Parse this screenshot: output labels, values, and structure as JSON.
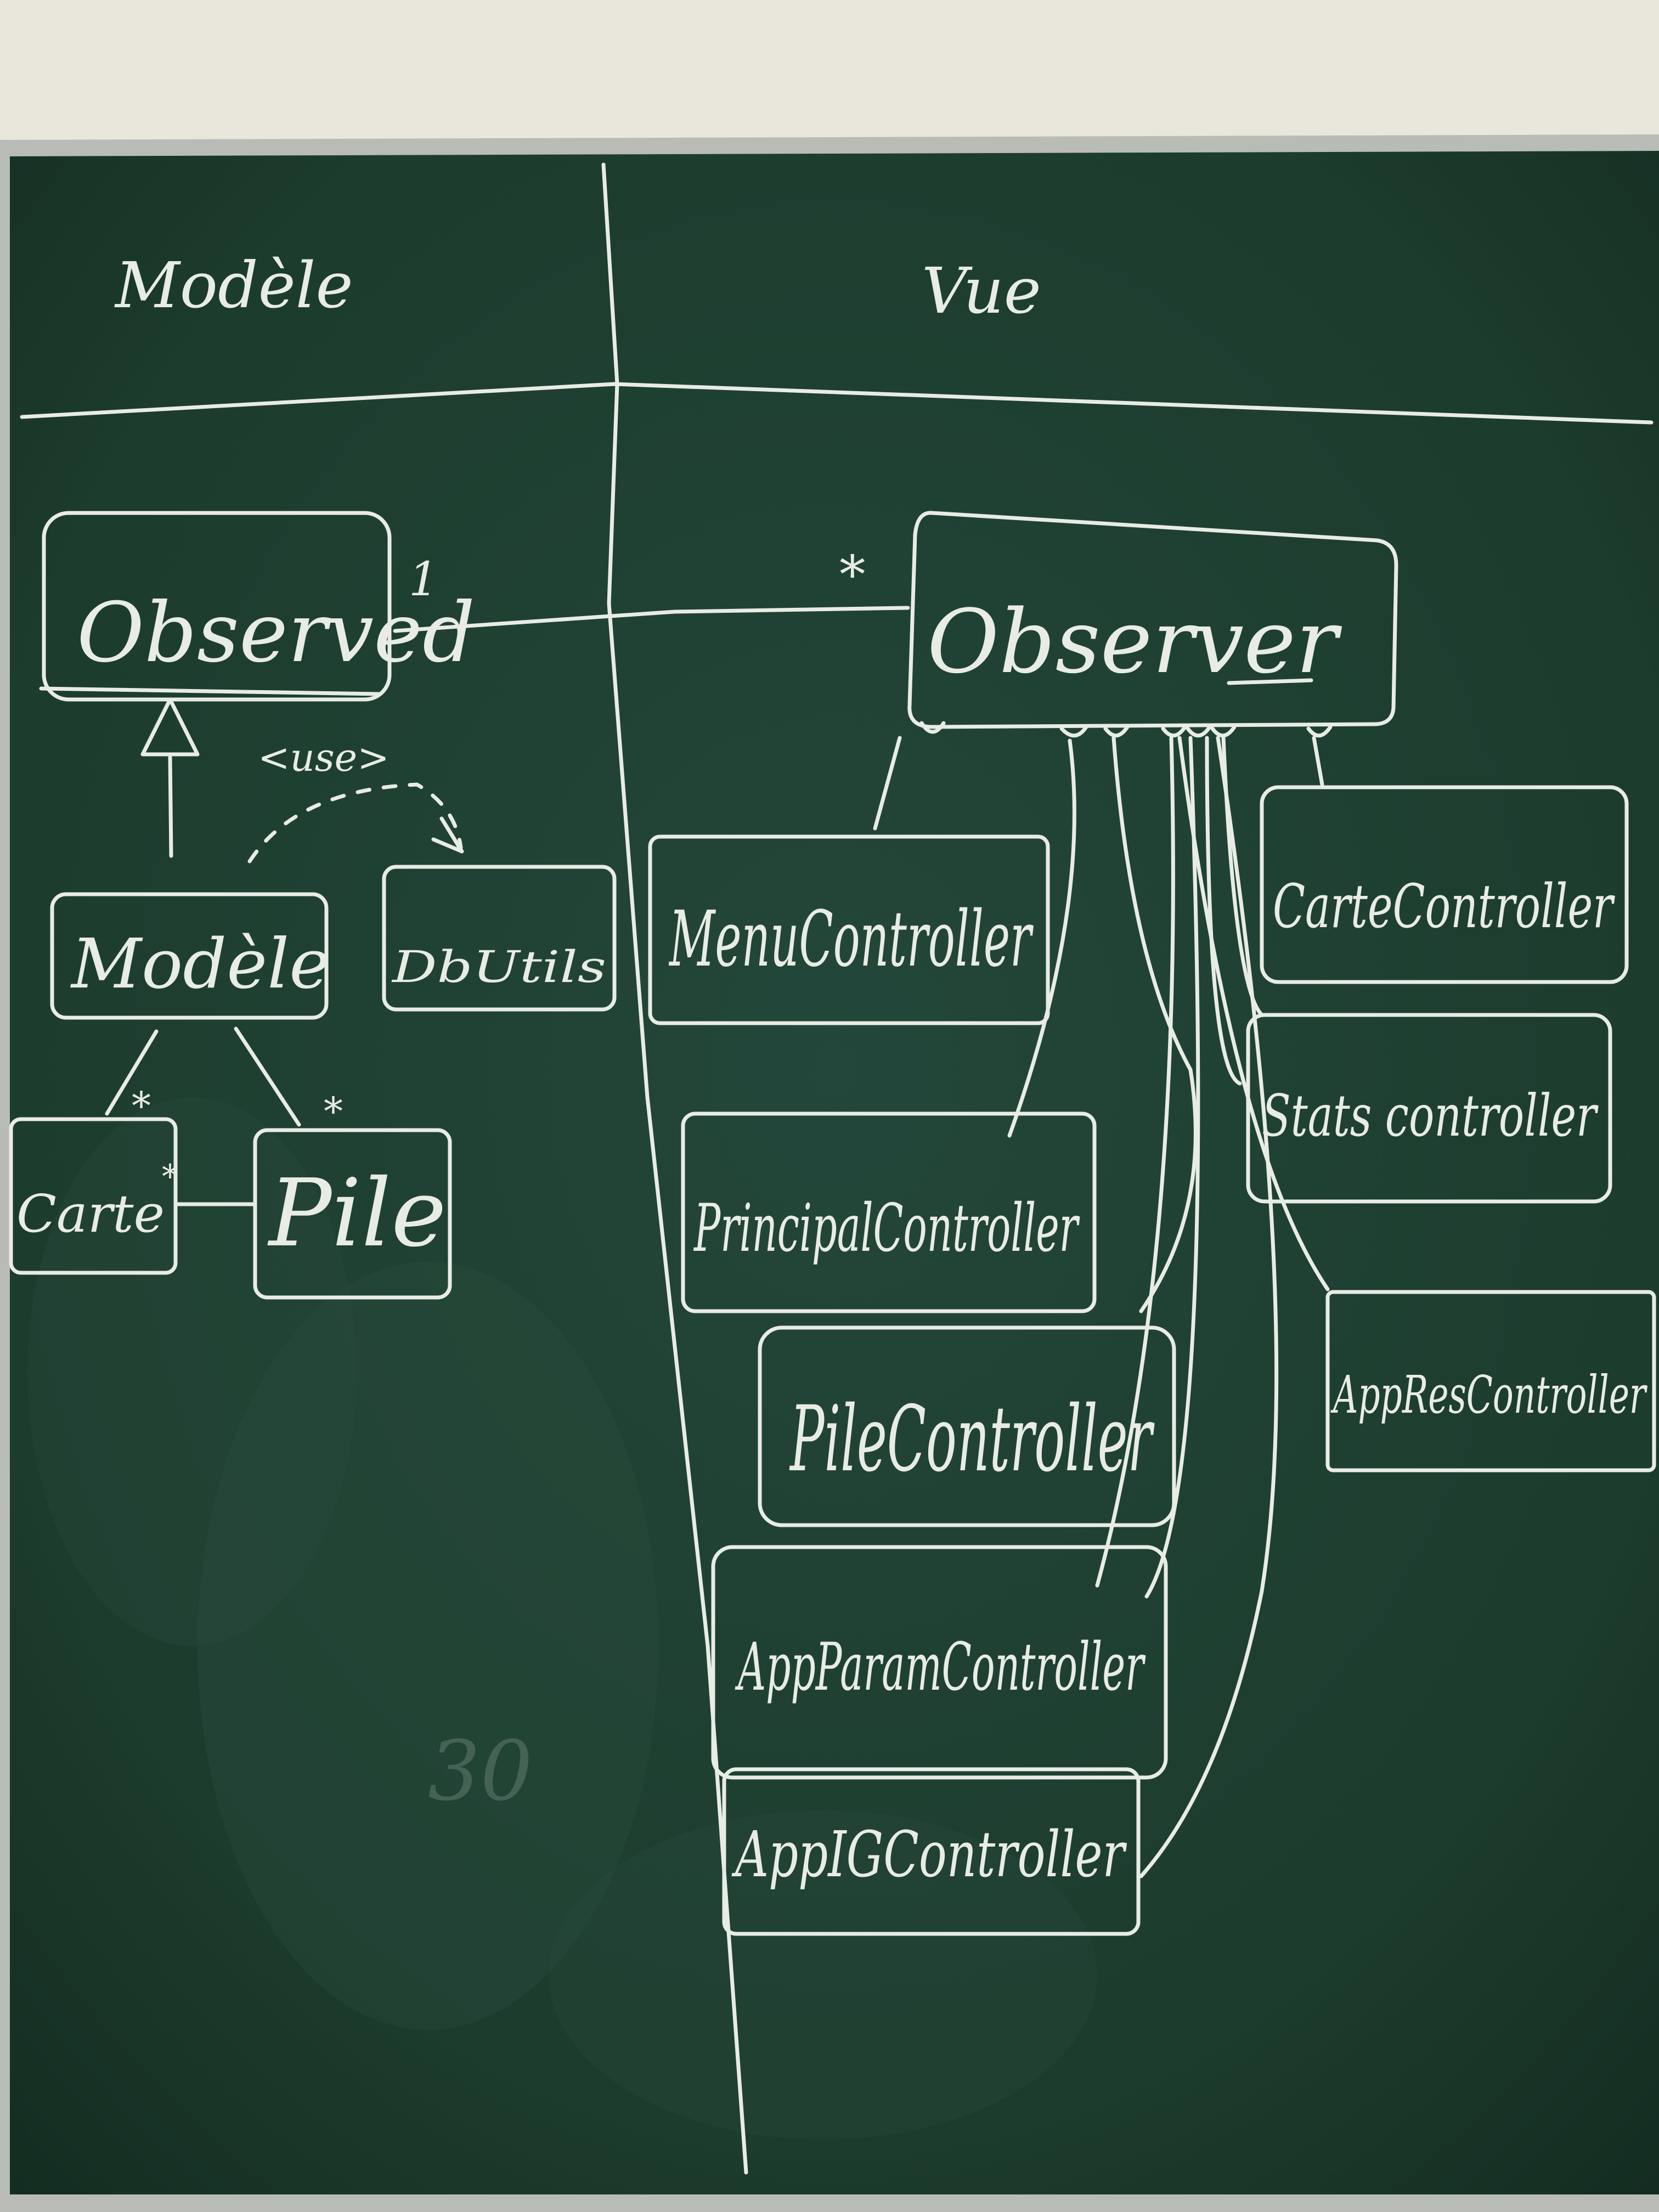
{
  "board": {
    "headers": {
      "model": "Modèle",
      "view": "Vue"
    },
    "stray_mark": "30"
  },
  "classes": {
    "observed": "Observed",
    "observer": "Observer",
    "modele": "Modèle",
    "dbutils": "DbUtils",
    "carte": "Carte",
    "pile": "Pile",
    "menu_controller": "MenuController",
    "carte_controller": "CarteController",
    "principal_controller": "PrincipalController",
    "stats_controller": "Stats controller",
    "pile_controller": "PileController",
    "app_res_controller": "AppResController",
    "app_param_controller": "AppParamController",
    "app_ig_controller": "AppIGController"
  },
  "relations": {
    "observed_multiplicity": "1",
    "observer_multiplicity": "*",
    "use_stereotype": "<use>",
    "carte_multiplicity": "*",
    "pile_multiplicity": "*",
    "carte_pile_multiplicity": "*"
  },
  "colors": {
    "board": "#1f4030",
    "frame": "#b9bcb6",
    "chalk": "#e8ece4",
    "wall": "#e9e6dc"
  }
}
